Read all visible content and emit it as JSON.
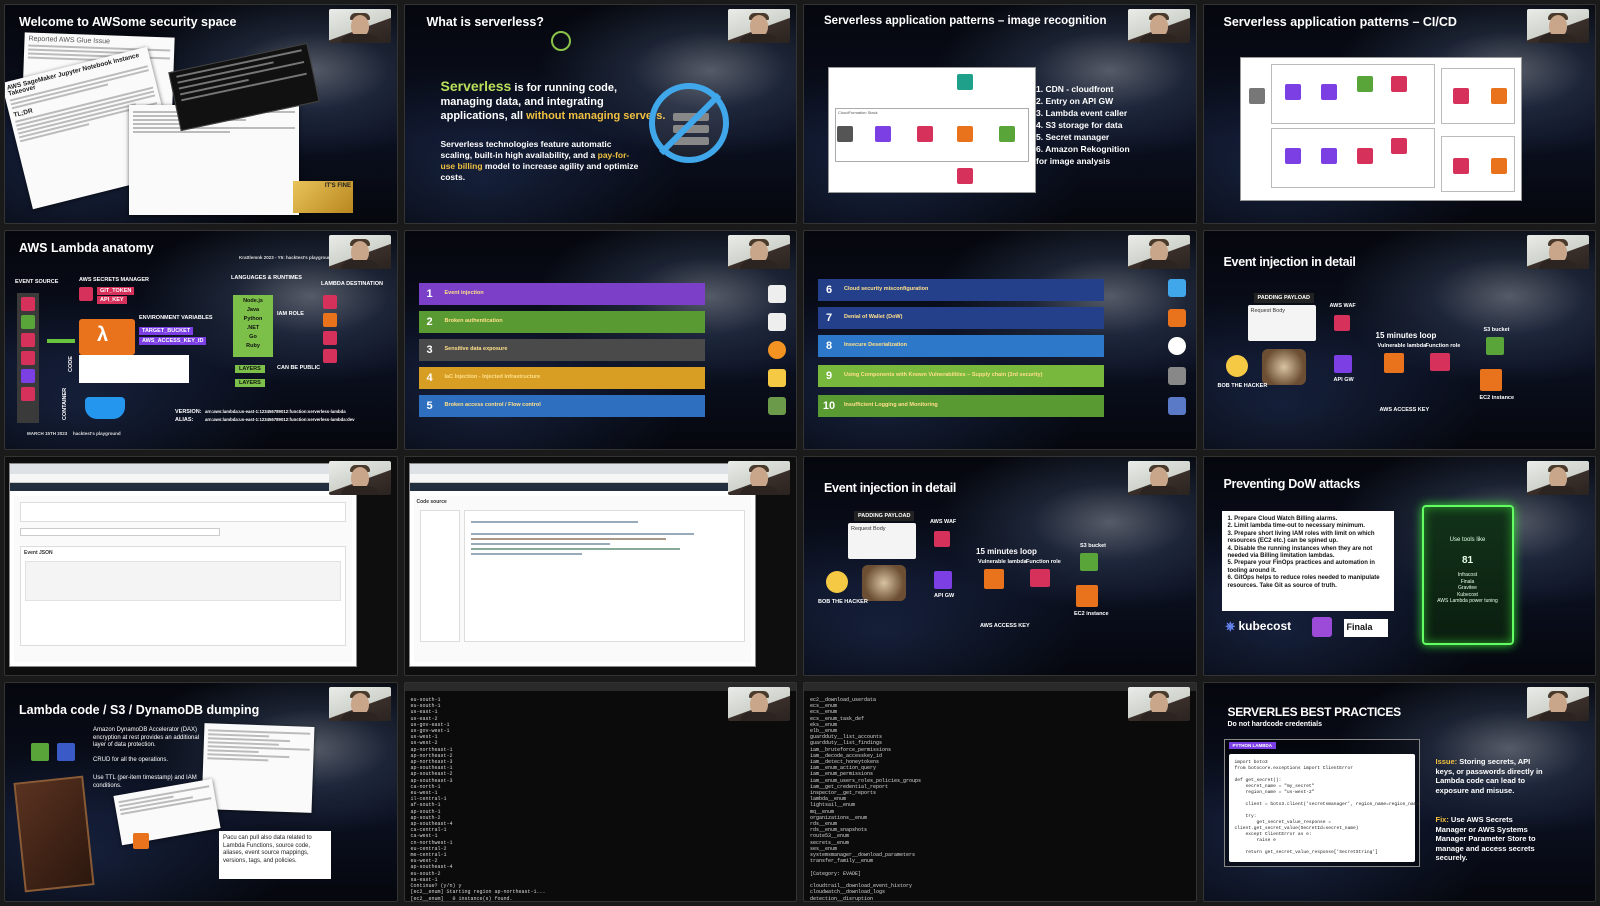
{
  "tiles": {
    "t1": {
      "title": "Welcome to AWSome security space",
      "paper_title": "Reported AWS Glue Issue",
      "paper2_title": "AWS SageMaker Jupyter Notebook Instance Takeover",
      "tldr": "TL;DR",
      "meme_text": "IT'S FINE"
    },
    "t2": {
      "title": "What is serverless?",
      "big_1": "Serverless",
      "big_2": " is for running code, managing data, and integrating applications, all ",
      "big_3": "without managing servers.",
      "small_1": "Serverless technologies feature automatic scaling, built-in high availability, and a ",
      "small_2": "pay-for-use billing",
      "small_3": " model to increase agility and optimize costs."
    },
    "t3": {
      "title": "Serverless application patterns – image recognition",
      "items": [
        "1.  CDN - cloudfront",
        "2.  Entry on API GW",
        "3.  Lambda event caller",
        "4.  S3 storage for data",
        "5.  Secret manager",
        "6.  Amazon Rekognition",
        "      for image analysis"
      ],
      "diagram_box": "CloudFormation Stack",
      "diagram_labels": [
        "Client",
        "Amazon CloudFront",
        "Amazon API Gateway",
        "AWS Lambda",
        "Amazon Simple Storage Service (Amazon S3)",
        "Amazon Rekognition",
        "AWS Secrets Manager"
      ]
    },
    "t4": {
      "title": "Serverless application patterns – CI/CD"
    },
    "t5": {
      "title": "AWS Lambda anatomy",
      "header": "Krattlemnk 2023 - Y5: hacktest's playground",
      "event_source": "EVENT SOURCE",
      "secrets_manager": "AWS SECRETS MANAGER",
      "git_token": "GIT_TOKEN",
      "api_key": "API_KEY",
      "env_vars": "ENVIRONMENT VARIABLES",
      "target_bucket": "TARGET_BUCKET",
      "access_key": "AWS_ACCESS_KEY_ID",
      "lambda": "LAMBDA",
      "languages": "LANGUAGES & RUNTIMES",
      "runtimes": [
        "Node.js",
        "Java",
        "Python",
        ".NET",
        "Go",
        "Ruby"
      ],
      "iam_role": "IAM ROLE",
      "destination": "LAMBDA DESTINATION",
      "layers_1": "LAYERS",
      "layers_2": "LAYERS",
      "can_be_public": "CAN BE PUBLIC",
      "code": "CODE",
      "container": "CONTAINER",
      "version": "VERSION:",
      "alias": "ALIAS:",
      "version_val": "arn:aws:lambda:us-east-1:123456789012:function:serverless-lambda",
      "alias_val": "arn:aws:lambda:us-east-1:123456789012:function:serverless-lambda:dev",
      "footer": "MARCH 15TH 2023",
      "footer2": "hacktest's playground"
    },
    "t6": {
      "rows": [
        {
          "n": "1",
          "title": "Event injection",
          "color": "#7b3fc8"
        },
        {
          "n": "2",
          "title": "Broken authentication",
          "color": "#5a9a32"
        },
        {
          "n": "3",
          "title": "Sensitive data exposure",
          "color": "#4a4a4a"
        },
        {
          "n": "4",
          "title": "IaC Injection - Injected infrastructure",
          "color": "#d89e24"
        },
        {
          "n": "5",
          "title": "Broken access control / Flow control",
          "color": "#2f6fc0"
        }
      ]
    },
    "t7": {
      "rows": [
        {
          "n": "6",
          "title": "Cloud security misconfiguration",
          "color": "#24408a"
        },
        {
          "n": "7",
          "title": "Denial of Wallet (DoW)",
          "color": "#24408a"
        },
        {
          "n": "8",
          "title": "Insecure Deserialization",
          "color": "#2d78c8"
        },
        {
          "n": "9",
          "title": "Using Components with Known Vulnerabilities – Supply chain (3rd security)",
          "color": "#78b83c"
        },
        {
          "n": "10",
          "title": "Insufficient Logging and Monitoring",
          "color": "#5a9a32"
        }
      ]
    },
    "t8": {
      "title": "Event injection in detail",
      "padding_payload": "PADDING PAYLOAD",
      "request_body": "Request Body",
      "aws_waf": "AWS WAF",
      "loop": "15 minutes loop",
      "vuln_lambda": "Vulnerable lambda",
      "function_role": "Function role",
      "s3_bucket": "S3 bucket",
      "api_gw": "API GW",
      "hacker": "BOB THE HACKER",
      "access_key": "AWS ACCESS KEY",
      "ec2": "EC2 instance"
    },
    "t9": {
      "panel_title": "Event JSON"
    },
    "t10": {
      "panel_title": "Code source"
    },
    "t11": {
      "title": "Event injection in detail",
      "padding_payload": "PADDING PAYLOAD",
      "request_body": "Request Body",
      "aws_waf": "AWS WAF",
      "loop": "15 minutes loop",
      "vuln_lambda": "Vulnerable lambda",
      "function_role": "Function role",
      "s3_bucket": "S3 bucket",
      "api_gw": "API GW",
      "hacker": "BOB THE HACKER",
      "access_key": "AWS ACCESS KEY",
      "ec2": "EC2 instance"
    },
    "t12": {
      "title": "Preventing DoW attacks",
      "items": [
        "1. Prepare Cloud Watch Billing alarms.",
        "2. Limit lambda time-out to necessary minimum.",
        "3. Prepare short living IAM roles with limit on which resources (EC2 etc.) can be spined up.",
        "4. Disable the running instances when they are not needed via Billing limitation lambdas.",
        "5. Prepare your FinOps practices and automation in tooling around it.",
        "6. GitOps helps to reduce roles needed to manipulate resources. Take Git as source of truth."
      ],
      "kubecost": "kubecost",
      "finala": "Finala",
      "card_title": "Use tools like",
      "card_num": "81",
      "card_tools": [
        "Infracost",
        "Finala",
        "Gravitee",
        "Kubecost",
        "AWS Lambda power tuning"
      ]
    },
    "t13": {
      "title": "Lambda code / S3 / DynamoDB dumping",
      "dax": "Amazon DynamoDB Accelerator (DAX) encryption at rest provides an additional layer of data protection.",
      "crud": "CRUD for all the operations.",
      "ttl": "Use TTL (per-item timestamp) and IAM conditions.",
      "pacu": "Pacu can pull also data related to Lambda Functions, source code, aliases, event source mappings, versions, tags, and policies."
    },
    "t14": {
      "lines": "eu-south-1\neu-south-1\nus-east-1\nus-east-2\nus-gov-east-1\nus-gov-west-1\nus-west-1\nus-west-2\nap-northeast-1\nap-northeast-2\nap-northeast-3\nap-southeast-1\nap-southeast-2\nap-southeast-3\nca-north-1\neu-west-1\nil-central-1\naf-south-1\nap-south-1\nap-south-2\nap-southeast-4\nca-central-1\nca-west-1\ncn-northwest-1\neu-central-2\nme-central-1\neu-west-2\nap-southeast-4\neu-south-2\nsa-east-1\nContinue? (y/n) y\n[ec2__enum] Starting region ap-northeast-1...\n[ec2__enum]   0 instance(s) found."
    },
    "t15": {
      "lines": "ec2__download_userdata\necs__enum\necs__enum\necs__enum_task_def\neks__enum\nelb__enum\nguardduty__list_accounts\nguardduty__list_findings\niam__bruteforce_permissions\niam__decode_accesskey_id\niam__detect_honeytokens\niam__enum_action_query\niam__enum_permissions\niam__enum_users_roles_policies_groups\niam__get_credential_report\ninspector__get_reports\nlambda__enum\nlightsail__enum\nmq__enum\norganizations__enum\nrds__enum\nrds__enum_snapshots\nroute53__enum\nsecrets__enum\nses__enum\nsystemsmanager__download_parameters\ntransfer_family__enum\n\n[Category: EVADE]\n\ncloudtrail__download_event_history\ncloudwatch__download_logs\ndetection__disruption"
    },
    "t16": {
      "title": "SERVERLES BEST PRACTICES",
      "subtitle": "Do not hardcode credentials",
      "tab": "PYTHON LAMBDA",
      "code": "import boto3\nfrom botocore.exceptions import ClientError\n\ndef get_secret():\n    secret_name = \"my_secret\"\n    region_name = \"us-west-2\"\n\n    client = boto3.client('secretsmanager', region_name=region_name)\n\n    try:\n        get_secret_value_response =\nclient.get_secret_value(SecretId=secret_name)\n    except ClientError as e:\n        raise e\n\n    return get_secret_value_response['SecretString']",
      "issue_label": "Issue:",
      "issue_text": " Storing secrets, API keys, or passwords directly in Lambda code can lead to exposure and misuse.",
      "fix_label": "Fix:",
      "fix_text": " Use AWS Secrets Manager or AWS Systems Manager Parameter Store to manage and access secrets securely."
    }
  }
}
